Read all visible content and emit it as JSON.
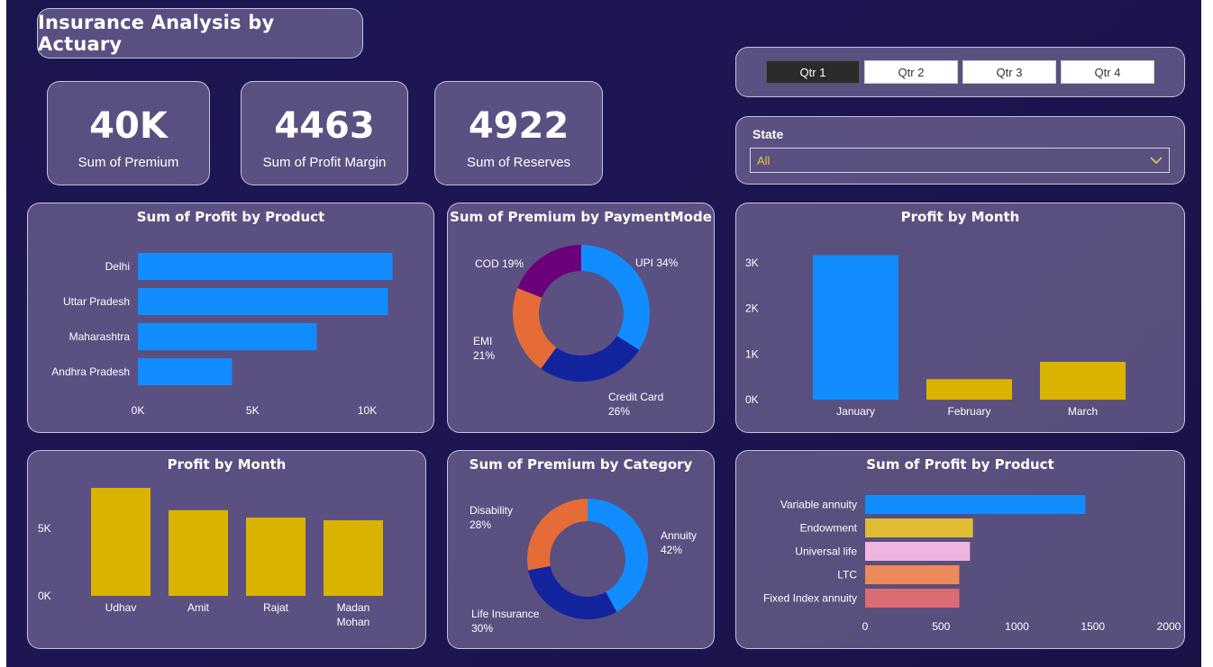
{
  "header": {
    "title": "Insurance Analysis by Actuary"
  },
  "kpis": [
    {
      "value": "40K",
      "label": "Sum of Premium"
    },
    {
      "value": "4463",
      "label": "Sum of Profit Margin"
    },
    {
      "value": "4922",
      "label": "Sum of Reserves"
    }
  ],
  "quarter_slicer": {
    "options": [
      "Qtr 1",
      "Qtr 2",
      "Qtr 3",
      "Qtr 4"
    ],
    "selected": "Qtr 1"
  },
  "state_slicer": {
    "label": "State",
    "value": "All"
  },
  "colors": {
    "blue": "#118DFF",
    "gold": "#D9B300",
    "dark_blue": "#12239E",
    "orange": "#E66C37",
    "purple": "#6B007B",
    "yellow": "#E0BC35",
    "pink": "#F0B4E0",
    "salmon": "#EC8A5C",
    "red": "#DD6B74"
  },
  "chart_data": [
    {
      "id": "profit-by-state",
      "type": "bar",
      "orientation": "horizontal",
      "title": "Sum of Profit by Product",
      "categories": [
        "Delhi",
        "Uttar Pradesh",
        "Maharashtra",
        "Andhra Pradesh"
      ],
      "values": [
        11100,
        10900,
        7800,
        4100
      ],
      "xlim": [
        0,
        11000
      ],
      "x_ticks": [
        0,
        5000,
        10000
      ],
      "x_tick_labels": [
        "0K",
        "5K",
        "10K"
      ],
      "grid": false,
      "bar_colors": [
        "#118DFF",
        "#118DFF",
        "#118DFF",
        "#118DFF"
      ]
    },
    {
      "id": "premium-by-paymentmode",
      "type": "pie",
      "donut": true,
      "title": "Sum of Premium by PaymentMode",
      "slices": [
        {
          "label": "UPI",
          "percent_text": "34%",
          "value": 34,
          "color": "#118DFF"
        },
        {
          "label": "Credit Card",
          "percent_text": "26%",
          "value": 26,
          "color": "#12239E"
        },
        {
          "label": "EMI",
          "percent_text": "21%",
          "value": 21,
          "color": "#E66C37"
        },
        {
          "label": "COD",
          "percent_text": "19%",
          "value": 19,
          "color": "#6B007B"
        }
      ]
    },
    {
      "id": "profit-by-month-1",
      "type": "bar",
      "orientation": "vertical",
      "title": "Profit by Month",
      "categories": [
        "January",
        "February",
        "March"
      ],
      "values": [
        3170,
        450,
        830
      ],
      "ylim": [
        0,
        3000
      ],
      "y_ticks": [
        0,
        1000,
        2000,
        3000
      ],
      "y_tick_labels": [
        "0K",
        "1K",
        "2K",
        "3K"
      ],
      "grid": false,
      "bar_colors": [
        "#118DFF",
        "#D9B300",
        "#D9B300"
      ]
    },
    {
      "id": "profit-by-month-2",
      "type": "bar",
      "orientation": "vertical",
      "title": "Profit by Month",
      "categories": [
        [
          "Udhav"
        ],
        [
          "Amit"
        ],
        [
          "Rajat"
        ],
        [
          "Madan",
          "Mohan"
        ]
      ],
      "values": [
        8000,
        6350,
        5800,
        5600
      ],
      "ylim": [
        0,
        5000
      ],
      "y_ticks": [
        0,
        5000
      ],
      "y_tick_labels": [
        "0K",
        "5K"
      ],
      "grid": false,
      "bar_colors": [
        "#D9B300",
        "#D9B300",
        "#D9B300",
        "#D9B300"
      ]
    },
    {
      "id": "premium-by-category",
      "type": "pie",
      "donut": true,
      "title": "Sum of Premium by Category",
      "slices": [
        {
          "label": "Annuity",
          "percent_text": "42%",
          "value": 42,
          "color": "#118DFF"
        },
        {
          "label": "Life Insurance",
          "percent_text": "30%",
          "value": 30,
          "color": "#12239E"
        },
        {
          "label": "Disability",
          "percent_text": "28%",
          "value": 28,
          "color": "#E66C37"
        }
      ]
    },
    {
      "id": "profit-by-product",
      "type": "bar",
      "orientation": "horizontal",
      "title": "Sum of Profit by Product",
      "categories": [
        "Variable annuity",
        "Endowment",
        "Universal life",
        "LTC",
        "Fixed Index annuity"
      ],
      "values": [
        1450,
        710,
        690,
        620,
        620
      ],
      "xlim": [
        0,
        2000
      ],
      "x_ticks": [
        0,
        500,
        1000,
        1500,
        2000
      ],
      "x_tick_labels": [
        "0",
        "500",
        "1000",
        "1500",
        "2000"
      ],
      "grid": false,
      "bar_colors": [
        "#118DFF",
        "#E0BC35",
        "#F0B4E0",
        "#EC8A5C",
        "#DD6B74"
      ]
    }
  ]
}
